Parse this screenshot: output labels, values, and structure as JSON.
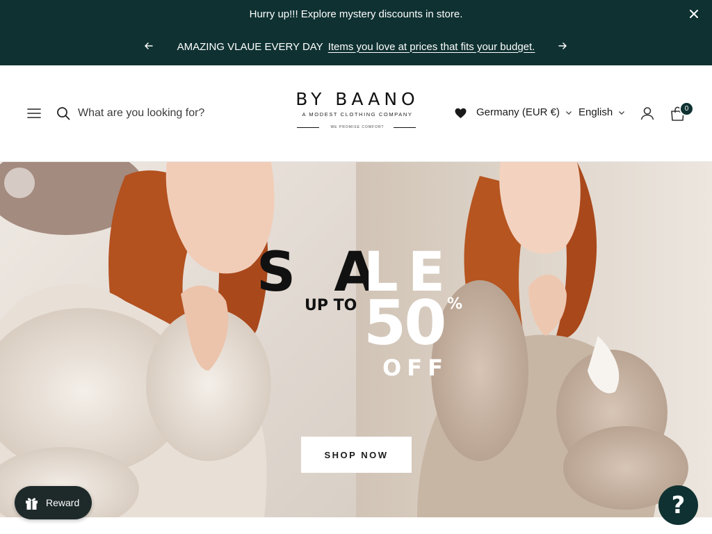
{
  "announcement": {
    "top_text": "Hurry up!!! Explore mystery discounts in store.",
    "slide_lead": "AMAZING VLAUE EVERY DAY",
    "slide_link": "Items you love at prices that fits your budget.",
    "background_color": "#0f3131"
  },
  "header": {
    "search_placeholder": "What are you looking for?",
    "logo": {
      "main": "BY BAANO",
      "sub": "A MODEST CLOTHING COMPANY",
      "tagline": "WE PROMISE COMFORT"
    },
    "country_selector": "Germany (EUR €)",
    "language_selector": "English",
    "cart_count": "0"
  },
  "hero": {
    "headline_dark": "S A",
    "headline_light": "LE",
    "up_to": "UP TO",
    "percent_value": "50",
    "percent_sign": "%",
    "off": "OFF",
    "cta_label": "SHOP NOW"
  },
  "widgets": {
    "reward_label": "Reward",
    "help_symbol": "?"
  },
  "icons": [
    "close-icon",
    "arrow-left-icon",
    "arrow-right-icon",
    "menu-icon",
    "search-icon",
    "heart-icon",
    "chevron-down-icon",
    "account-icon",
    "cart-icon",
    "gift-icon",
    "help-icon"
  ]
}
